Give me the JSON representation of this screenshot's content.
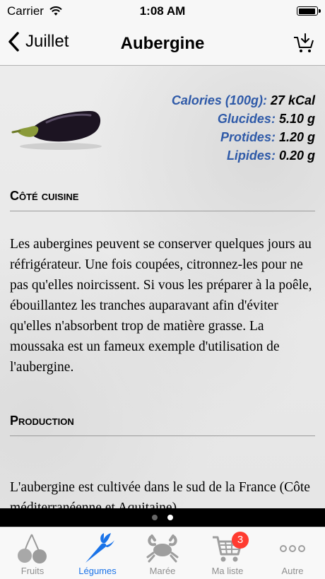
{
  "status_bar": {
    "carrier": "Carrier",
    "time": "1:08 AM"
  },
  "nav": {
    "back_label": "Juillet",
    "title": "Aubergine",
    "action_icon": "add-to-cart-icon"
  },
  "nutrition": [
    {
      "label": "Calories (100g):",
      "value": "27 kCal"
    },
    {
      "label": "Glucides:",
      "value": "5.10 g"
    },
    {
      "label": "Protides:",
      "value": "1.20 g"
    },
    {
      "label": "Lipides:",
      "value": "0.20 g"
    }
  ],
  "sections": [
    {
      "title": "Côté cuisine",
      "text": "Les aubergines peuvent se conserver quelques jours au réfrigérateur. Une fois coupées, citronnez-les pour ne pas qu'elles noircissent. Si vous les préparer à la poêle, ébouillantez les tranches auparavant afin d'éviter qu'elles n'absorbent trop de matière grasse. La moussaka est un fameux exemple d'utilisation de l'aubergine."
    },
    {
      "title": "Production",
      "text": "L'aubergine est cultivée dans le sud de la France (Côte méditerranéenne et Aquitaine)"
    }
  ],
  "page_control": {
    "pages": 2,
    "current": 2
  },
  "tabs": [
    {
      "label": "Fruits",
      "icon": "cherries-icon",
      "active": false
    },
    {
      "label": "Légumes",
      "icon": "carrot-icon",
      "active": true
    },
    {
      "label": "Marée",
      "icon": "crab-icon",
      "active": false
    },
    {
      "label": "Ma liste",
      "icon": "shopping-cart-icon",
      "active": false,
      "badge": "3"
    },
    {
      "label": "Autre",
      "icon": "more-icon",
      "active": false
    }
  ],
  "colors": {
    "accent": "#1a73e8",
    "nutrition_label": "#2f5aa8",
    "badge": "#ff3b30"
  }
}
